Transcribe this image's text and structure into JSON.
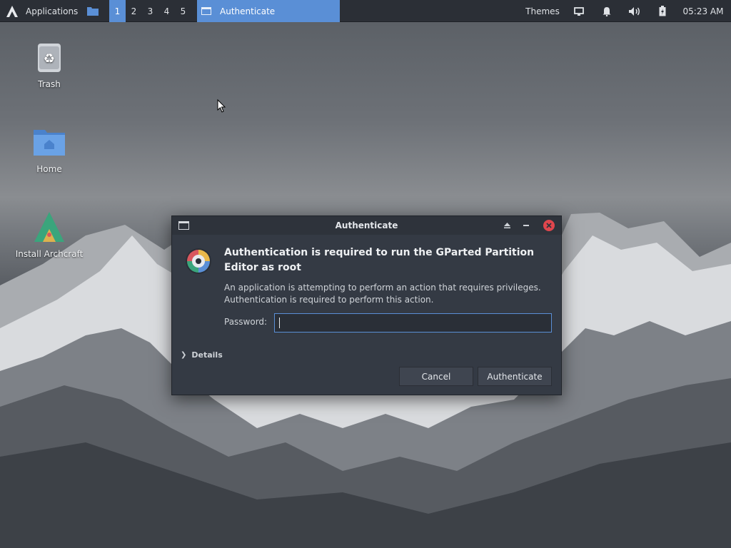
{
  "panel": {
    "applications_label": "Applications",
    "workspaces": [
      "1",
      "2",
      "3",
      "4",
      "5"
    ],
    "active_workspace": "1",
    "task_label": "Authenticate",
    "themes_label": "Themes",
    "clock": "05:23 AM",
    "icons": [
      "archcraft-logo-icon",
      "folder-icon",
      "window-icon",
      "display-icon",
      "bell-icon",
      "volume-icon",
      "battery-icon"
    ]
  },
  "desktop": {
    "icons": [
      {
        "label": "Trash",
        "icon": "trash-icon"
      },
      {
        "label": "Home",
        "icon": "folder-home-icon"
      },
      {
        "label": "Install Archcraft",
        "icon": "archcraft-installer-icon"
      }
    ]
  },
  "dialog": {
    "title": "Authenticate",
    "heading": "Authentication is required to run the GParted Partition Editor as root",
    "description_line1": "An application is attempting to perform an action that requires privileges.",
    "description_line2": "Authentication is required to perform this action.",
    "password_label": "Password:",
    "password_value": "",
    "details_label": "Details",
    "cancel_label": "Cancel",
    "authenticate_label": "Authenticate"
  },
  "colors": {
    "accent": "#5a8fd6",
    "close": "#e0464d",
    "panel_bg": "#2b2f36",
    "dialog_bg": "#343a44"
  }
}
